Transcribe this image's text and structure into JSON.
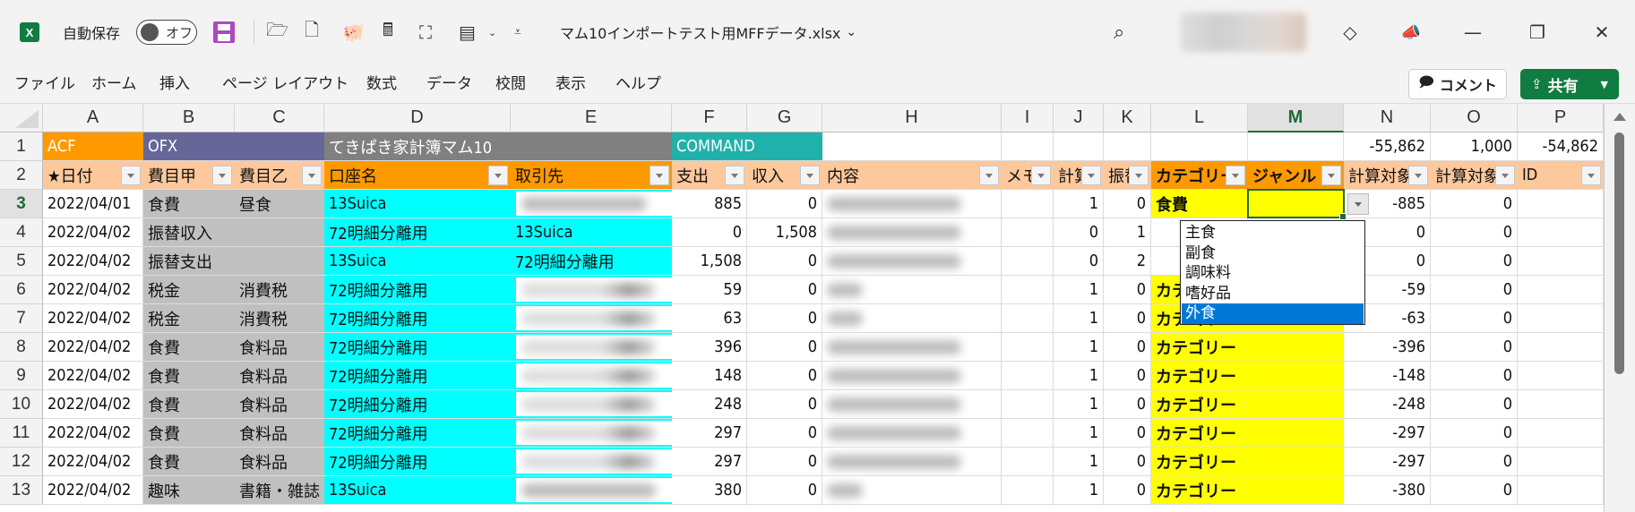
{
  "titlebar": {
    "autosave_label": "自動保存",
    "autosave_state": "オフ",
    "doc_title": "マム10インポートテスト用MFFデータ.xlsx",
    "doc_title_chevron": "⌄",
    "qa_icons": [
      {
        "name": "open-folder-icon",
        "glyph": "🗁"
      },
      {
        "name": "new-file-icon",
        "glyph": "🗋"
      },
      {
        "name": "piggy-bank-icon",
        "glyph": "🐖"
      },
      {
        "name": "calculator-icon",
        "glyph": "🖩"
      },
      {
        "name": "org-chart-icon",
        "glyph": "⛶"
      },
      {
        "name": "form-icon",
        "glyph": "▤"
      },
      {
        "name": "customize-qat-icon",
        "glyph": "⩡"
      }
    ],
    "search_glyph": "⌕",
    "diamond_glyph": "◇",
    "megaphone_glyph": "📣",
    "minimize_glyph": "—",
    "restore_glyph": "❐",
    "close_glyph": "✕"
  },
  "ribbon": {
    "tabs": [
      "ファイル",
      "ホーム",
      "挿入",
      "ページ レイアウト",
      "数式",
      "データ",
      "校閲",
      "表示",
      "ヘルプ"
    ],
    "comment_label": "コメント",
    "share_label": "共有"
  },
  "sheet": {
    "columns": [
      "A",
      "B",
      "C",
      "D",
      "E",
      "F",
      "G",
      "H",
      "I",
      "J",
      "K",
      "L",
      "M",
      "N",
      "O",
      "P"
    ],
    "selected_column": "M",
    "selected_row": "3",
    "row1": {
      "A": "ACF",
      "B": "OFX",
      "D": "てきぱき家計簿マム10",
      "F": "COMMAND",
      "N": "-55,862",
      "O": "1,000",
      "P": "-54,862"
    },
    "headers": {
      "A": "★日付",
      "B": "費目甲",
      "C": "費目乙",
      "D": "口座名",
      "E": "取引先",
      "F": "支出",
      "G": "収入",
      "H": "内容",
      "I": "メモ",
      "J": "計算",
      "K": "振替",
      "L": "カテゴリー",
      "M": "ジャンル",
      "N": "計算対象",
      "O": "計算対象",
      "P": "ID"
    },
    "rows": [
      {
        "num": "3",
        "A": "2022/04/01",
        "B": "食費",
        "C": "昼食",
        "D": "13Suica",
        "E": "",
        "F": "885",
        "G": "0",
        "J": "1",
        "K": "0",
        "L": "食費",
        "M": "",
        "N": "-885",
        "O": "0"
      },
      {
        "num": "4",
        "A": "2022/04/02",
        "B": "振替収入",
        "C": "",
        "D": "72明細分離用",
        "E": "13Suica",
        "F": "0",
        "G": "1,508",
        "J": "0",
        "K": "1",
        "L": "",
        "M": "",
        "N": "0",
        "O": "0"
      },
      {
        "num": "5",
        "A": "2022/04/02",
        "B": "振替支出",
        "C": "",
        "D": "13Suica",
        "E": "72明細分離用",
        "F": "1,508",
        "G": "0",
        "J": "0",
        "K": "2",
        "L": "",
        "M": "",
        "N": "0",
        "O": "0"
      },
      {
        "num": "6",
        "A": "2022/04/02",
        "B": "税金",
        "C": "消費税",
        "D": "72明細分離用",
        "E": "",
        "F": "59",
        "G": "0",
        "J": "1",
        "K": "0",
        "L": "カテゴリー",
        "M": "",
        "N": "-59",
        "O": "0"
      },
      {
        "num": "7",
        "A": "2022/04/02",
        "B": "税金",
        "C": "消費税",
        "D": "72明細分離用",
        "E": "",
        "F": "63",
        "G": "0",
        "J": "1",
        "K": "0",
        "L": "カテゴリー",
        "M": "",
        "N": "-63",
        "O": "0"
      },
      {
        "num": "8",
        "A": "2022/04/02",
        "B": "食費",
        "C": "食料品",
        "D": "72明細分離用",
        "E": "",
        "F": "396",
        "G": "0",
        "J": "1",
        "K": "0",
        "L": "カテゴリー",
        "M": "",
        "N": "-396",
        "O": "0"
      },
      {
        "num": "9",
        "A": "2022/04/02",
        "B": "食費",
        "C": "食料品",
        "D": "72明細分離用",
        "E": "",
        "F": "148",
        "G": "0",
        "J": "1",
        "K": "0",
        "L": "カテゴリー",
        "M": "",
        "N": "-148",
        "O": "0"
      },
      {
        "num": "10",
        "A": "2022/04/02",
        "B": "食費",
        "C": "食料品",
        "D": "72明細分離用",
        "E": "",
        "F": "248",
        "G": "0",
        "J": "1",
        "K": "0",
        "L": "カテゴリー",
        "M": "",
        "N": "-248",
        "O": "0"
      },
      {
        "num": "11",
        "A": "2022/04/02",
        "B": "食費",
        "C": "食料品",
        "D": "72明細分離用",
        "E": "",
        "F": "297",
        "G": "0",
        "J": "1",
        "K": "0",
        "L": "カテゴリー",
        "M": "",
        "N": "-297",
        "O": "0"
      },
      {
        "num": "12",
        "A": "2022/04/02",
        "B": "食費",
        "C": "食料品",
        "D": "72明細分離用",
        "E": "",
        "F": "297",
        "G": "0",
        "J": "1",
        "K": "0",
        "L": "カテゴリー",
        "M": "",
        "N": "-297",
        "O": "0"
      },
      {
        "num": "13",
        "A": "2022/04/02",
        "B": "趣味",
        "C": "書籍・雑誌",
        "D": "13Suica",
        "E": "",
        "F": "380",
        "G": "0",
        "J": "1",
        "K": "0",
        "L": "カテゴリー",
        "M": "",
        "N": "-380",
        "O": "0"
      }
    ],
    "blurred_E_rows": [
      "3",
      "6",
      "7",
      "8",
      "9",
      "10",
      "11",
      "12",
      "13"
    ],
    "blurred_H_rows": [
      "3",
      "4",
      "5",
      "6",
      "7",
      "8",
      "9",
      "10",
      "11",
      "12",
      "13"
    ]
  },
  "dropdown": {
    "options": [
      "主食",
      "副食",
      "調味料",
      "嗜好品",
      "外食"
    ],
    "highlighted": "外食"
  },
  "colors": {
    "acf_orange": "#ff9900",
    "ofx_purple": "#666699",
    "mam_gray": "#808080",
    "command_teal": "#20b2aa",
    "header_peach": "#fcc89c",
    "header_orange": "#ff9900",
    "gray_fill": "#c0c0c0",
    "cyan_fill": "#00ffff",
    "yellow_fill": "#ffff00",
    "excel_green": "#107c41",
    "selection_blue": "#0078d7"
  }
}
